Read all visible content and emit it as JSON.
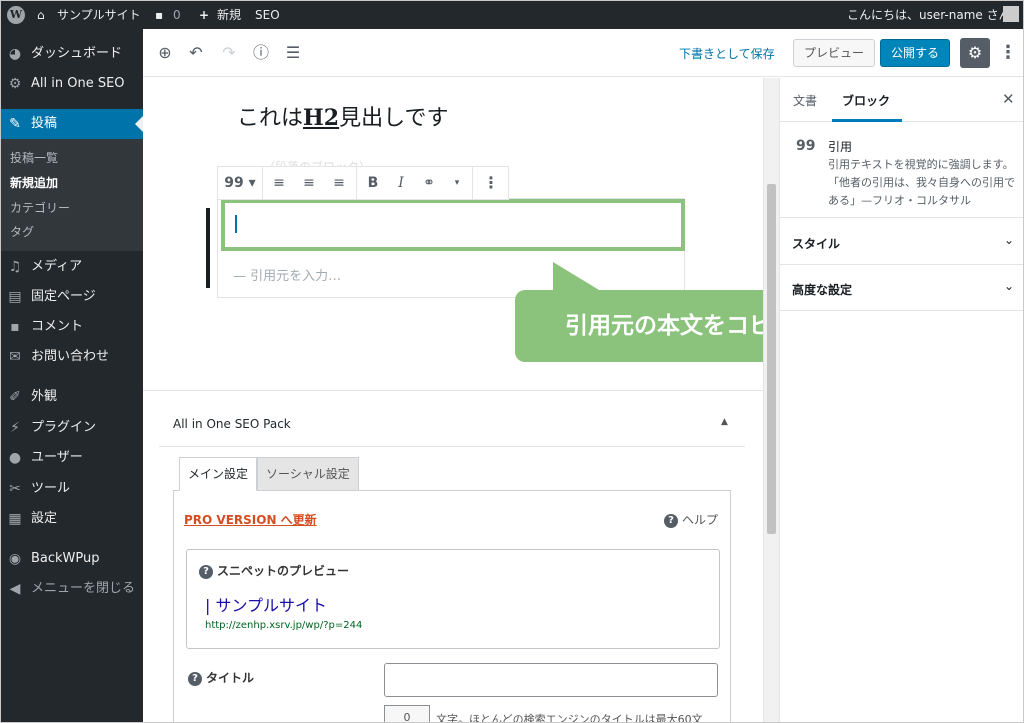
{
  "admin_bar": {
    "site_name": "サンプルサイト",
    "comment_count": "0",
    "new_label": "新規",
    "seo_label": "SEO",
    "greeting": "こんにちは、user-name さん"
  },
  "side_menu": {
    "items": [
      {
        "label": "ダッシュボード",
        "icon": "dashboard-icon"
      },
      {
        "label": "All in One SEO",
        "icon": "gear-icon"
      },
      {
        "label": "投稿",
        "icon": "pin-icon"
      },
      {
        "label": "メディア",
        "icon": "media-icon"
      },
      {
        "label": "固定ページ",
        "icon": "page-icon"
      },
      {
        "label": "コメント",
        "icon": "comment-icon"
      },
      {
        "label": "お問い合わせ",
        "icon": "mail-icon"
      },
      {
        "label": "外観",
        "icon": "brush-icon"
      },
      {
        "label": "プラグイン",
        "icon": "plugin-icon"
      },
      {
        "label": "ユーザー",
        "icon": "user-icon"
      },
      {
        "label": "ツール",
        "icon": "wrench-icon"
      },
      {
        "label": "設定",
        "icon": "settings-icon"
      },
      {
        "label": "BackWPup",
        "icon": "backwpup-icon"
      },
      {
        "label": "メニューを閉じる",
        "icon": "collapse-icon"
      }
    ],
    "submenu": [
      "投稿一覧",
      "新規追加",
      "カテゴリー",
      "タグ"
    ]
  },
  "editor_header": {
    "save_draft": "下書きとして保存",
    "preview": "プレビュー",
    "publish": "公開する"
  },
  "editor": {
    "heading_prefix": "これは",
    "heading_strong": "H2",
    "heading_suffix": "見出しです",
    "ghost_text": "（段落のブロック）",
    "cite_placeholder": "— 引用元を入力…",
    "callout": "引用元の本文をコピペする"
  },
  "seo_box": {
    "title": "All in One SEO Pack",
    "tab_main": "メイン設定",
    "tab_social": "ソーシャル設定",
    "pro_link": "PRO VERSION へ更新",
    "help": "ヘルプ",
    "snippet_heading": "スニペットのプレビュー",
    "snippet_title": "| サンプルサイト",
    "snippet_url": "http://zenhp.xsrv.jp/wp/?p=244",
    "title_label": "タイトル",
    "char_count": "0",
    "char_note": "文字。ほとんどの検索エンジンのタイトルは最大60文"
  },
  "sidebar": {
    "tab_document": "文書",
    "tab_block": "ブロック",
    "block_name": "引用",
    "block_desc": "引用テキストを視覚的に強調します。「他者の引用は、我々自身への引用である」—フリオ・コルタサル",
    "panel_style": "スタイル",
    "panel_advanced": "高度な設定"
  },
  "colors": {
    "admin_dark": "#23282d",
    "active_blue": "#0073aa",
    "callout_green": "#8bc37d",
    "publish_blue": "#0085ba",
    "pro_orange": "#d54e21"
  }
}
